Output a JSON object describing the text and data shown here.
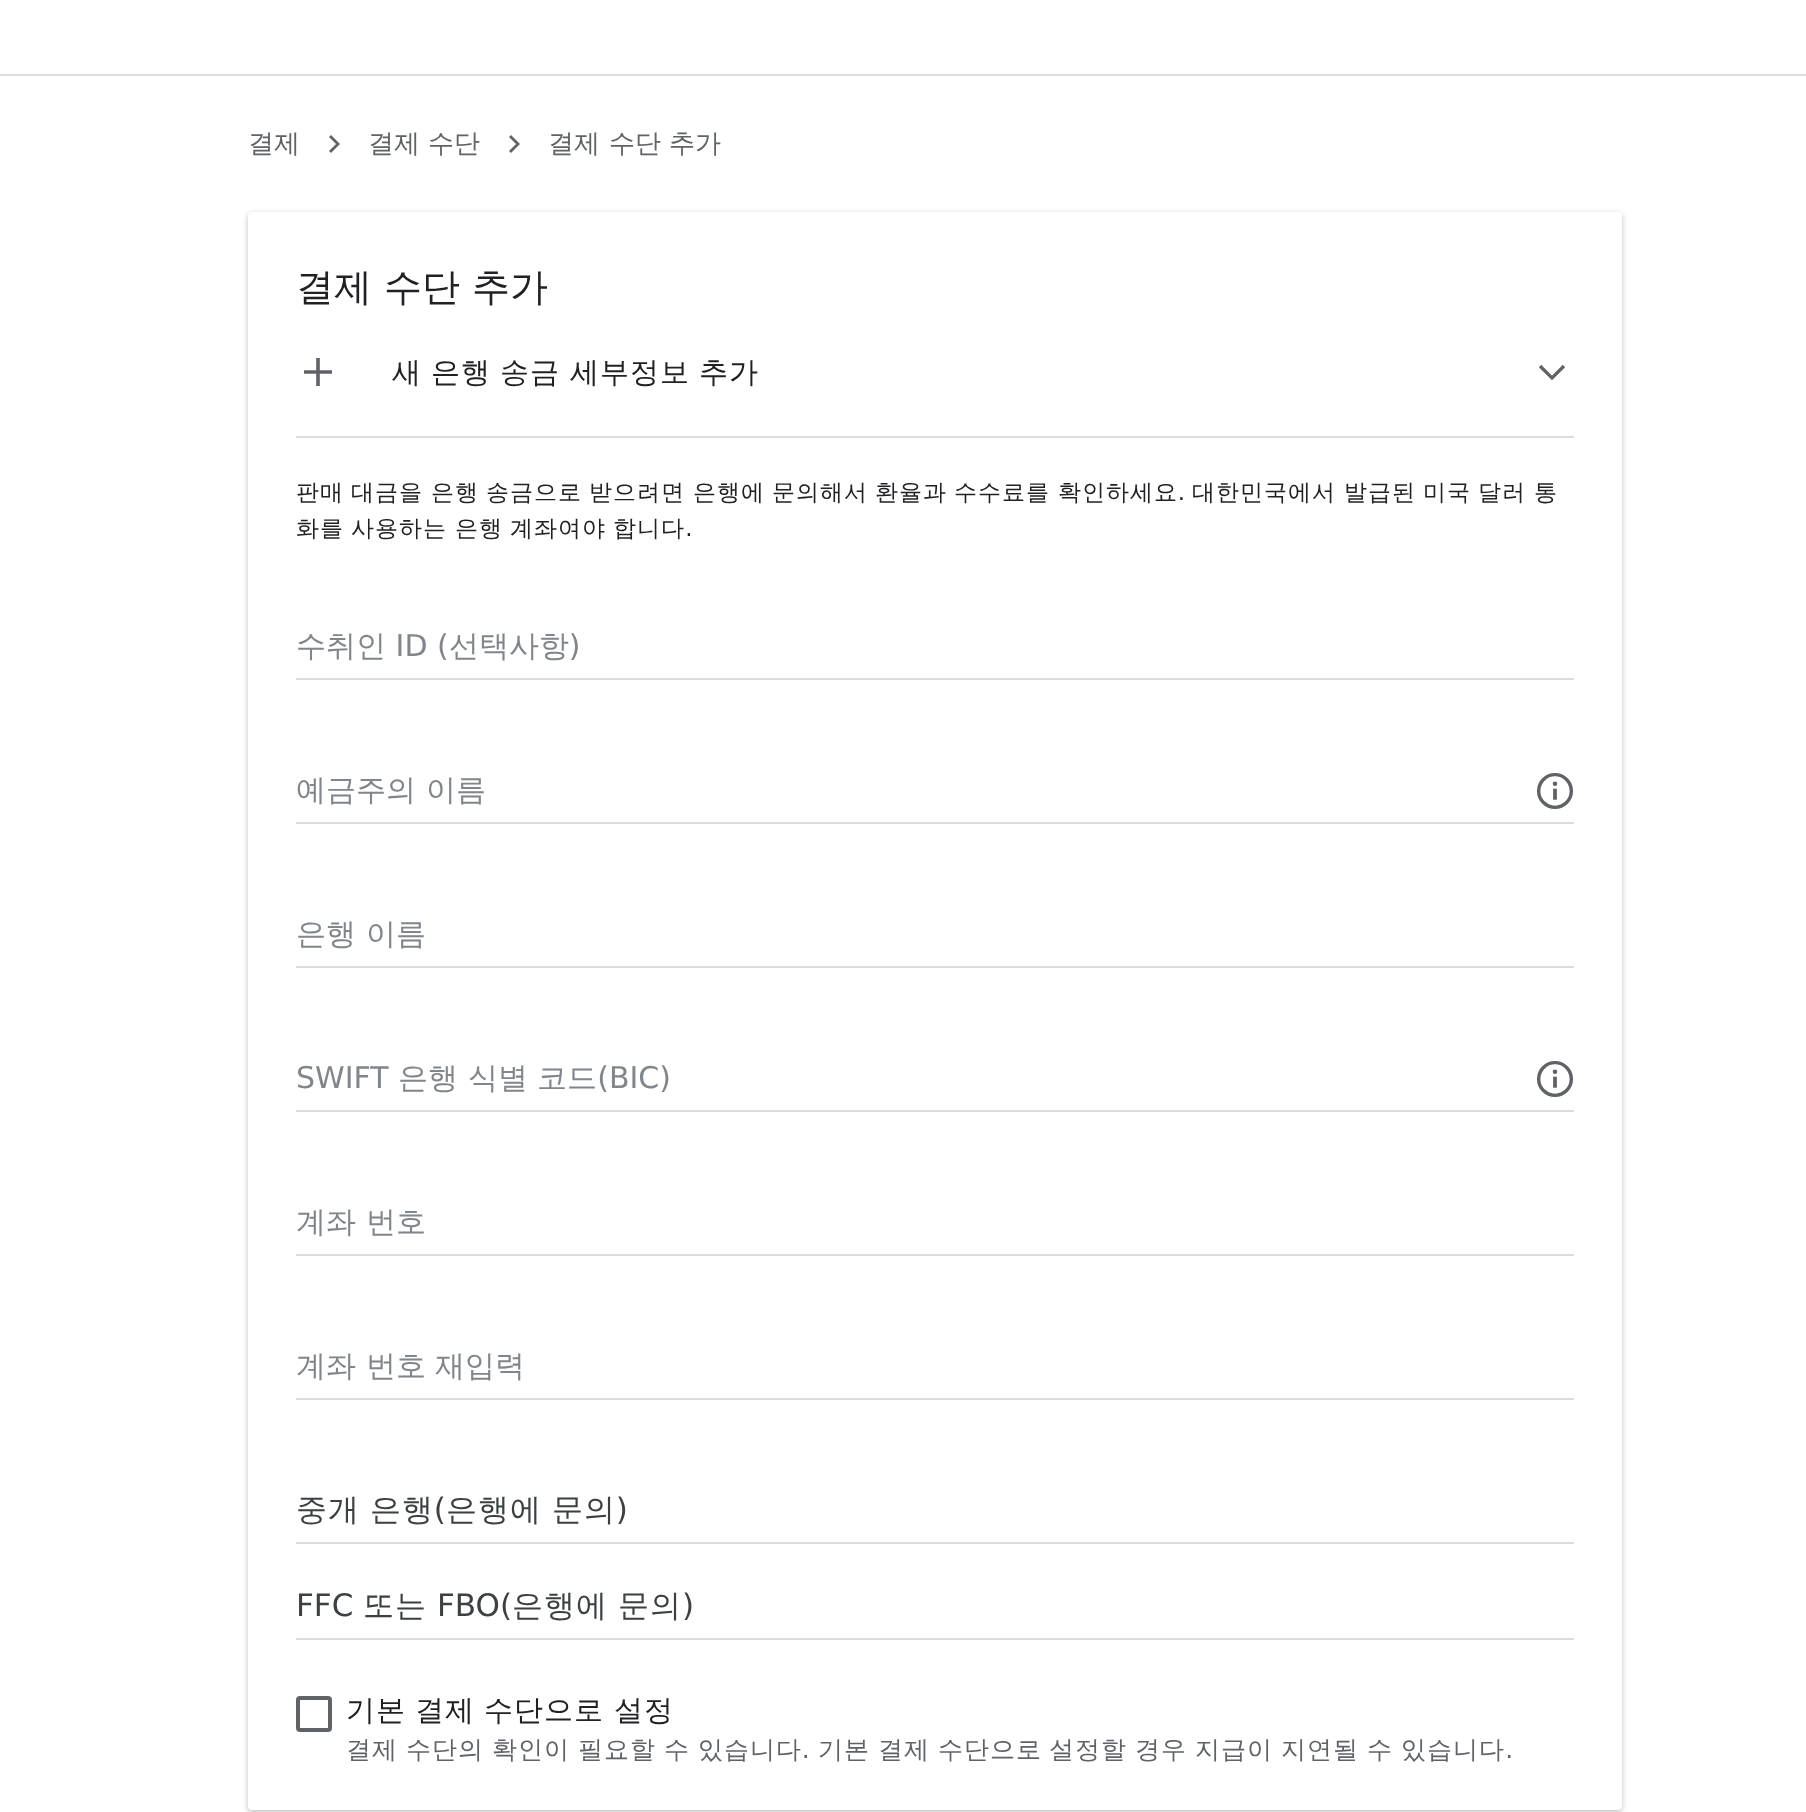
{
  "breadcrumb": [
    "결제",
    "결제 수단",
    "결제 수단 추가"
  ],
  "card": {
    "title": "결제 수단 추가",
    "section": {
      "label": "새 은행 송금 세부정보 추가",
      "expanded": false
    },
    "notice": "판매 대금을 은행 송금으로 받으려면 은행에 문의해서 환율과 수수료를 확인하세요. 대한민국에서 발급된 미국 달러 통화를 사용하는 은행 계좌여야 합니다.",
    "fields": [
      {
        "kind": "floating",
        "placeholder": "수취인 ID (선택사항)",
        "info": false
      },
      {
        "kind": "floating",
        "placeholder": "예금주의 이름",
        "info": true
      },
      {
        "kind": "floating",
        "placeholder": "은행 이름",
        "info": false
      },
      {
        "kind": "floating",
        "placeholder": "SWIFT 은행 식별 코드(BIC)",
        "info": true
      },
      {
        "kind": "floating",
        "placeholder": "계좌 번호",
        "info": false
      },
      {
        "kind": "floating",
        "placeholder": "계좌 번호 재입력",
        "info": false
      },
      {
        "kind": "compact",
        "placeholder": "중개 은행(은행에 문의)",
        "info": false
      },
      {
        "kind": "compact",
        "placeholder": "FFC 또는 FBO(은행에 문의)",
        "info": false
      }
    ],
    "default_option": {
      "label": "기본 결제 수단으로 설정",
      "hint": "결제 수단의 확인이 필요할 수 있습니다. 기본 결제 수단으로 설정할 경우 지급이 지연될 수 있습니다.",
      "checked": false
    }
  }
}
